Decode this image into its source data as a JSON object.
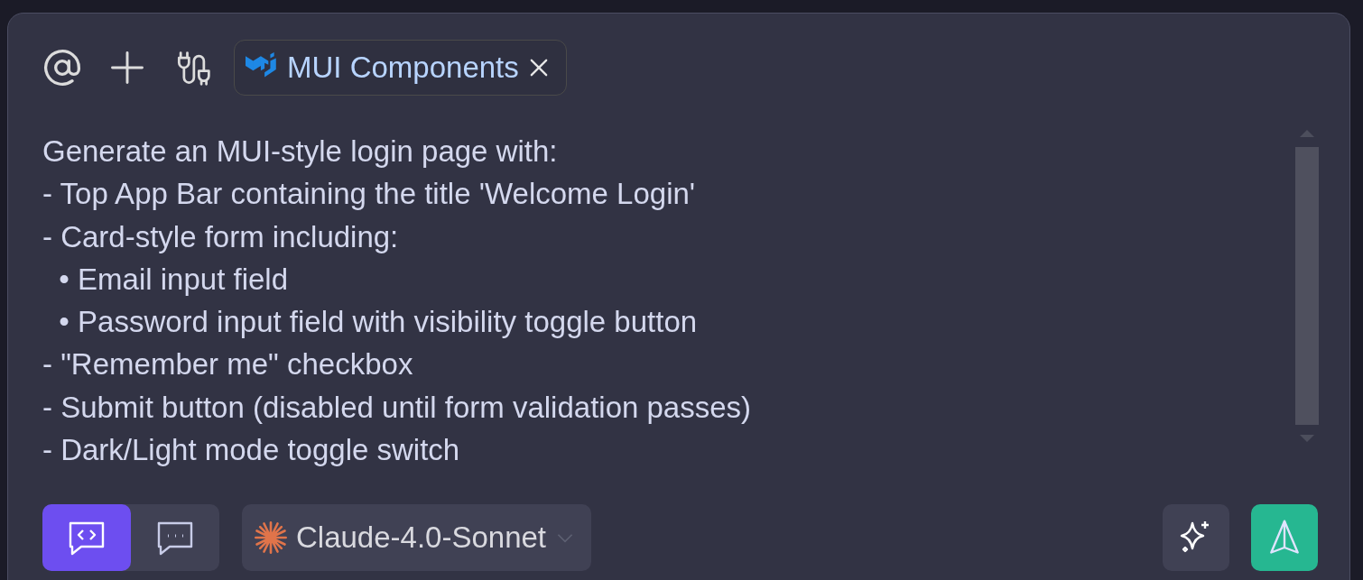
{
  "toolbar": {
    "context_chip": {
      "label": "MUI Components"
    }
  },
  "prompt": {
    "value": "Generate an MUI-style login page with:\n- Top App Bar containing the title 'Welcome Login'\n- Card-style form including:\n  • Email input field\n  • Password input field with visibility toggle button\n- \"Remember me\" checkbox\n- Submit button (disabled until form validation passes)\n- Dark/Light mode toggle switch"
  },
  "modes": [
    {
      "kind": "code",
      "selected": true
    },
    {
      "kind": "chat",
      "selected": false
    }
  ],
  "model": {
    "label": "Claude-4.0-Sonnet"
  }
}
